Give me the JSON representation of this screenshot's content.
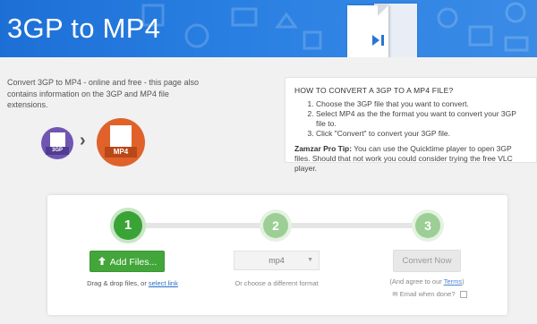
{
  "banner": {
    "title": "3GP to MP4",
    "pattern_icons": [
      "image-icon",
      "music-icon",
      "video-icon",
      "document-icon",
      "archive-icon"
    ],
    "colors": {
      "background": "#1d6fd6",
      "accent": "#ffffff"
    }
  },
  "intro": {
    "text": "Convert 3GP to MP4 - online and free - this page also contains information on the 3GP and MP4 file extensions."
  },
  "formats": {
    "from": {
      "label": "3GP",
      "color": "#6f56b2"
    },
    "to": {
      "label": "MP4",
      "color": "#e0622a"
    },
    "arrow": "›"
  },
  "howto": {
    "title": "HOW TO CONVERT A 3GP TO A MP4 FILE?",
    "steps": [
      "Choose the 3GP file that you want to convert.",
      "Select MP4 as the the format you want to convert your 3GP file to.",
      "Click \"Convert\" to convert your 3GP file."
    ],
    "tip_label": "Zamzar Pro Tip:",
    "tip_text": " You can use the Quicktime player to open 3GP files. Should that not work you could consider trying the free VLC player."
  },
  "converter": {
    "steps": [
      "1",
      "2",
      "3"
    ],
    "add_files_label": "Add Files...",
    "drag_text": "Drag & drop files, or ",
    "select_link": "select link",
    "format_value": "mp4",
    "format_hint": "Or choose a different format",
    "convert_label": "Convert Now",
    "agree_text": "(And agree to our ",
    "terms_link": "Terms",
    "agree_close": ")",
    "email_label": "Email when done?",
    "colors": {
      "step_active": "#3aa335",
      "step_inactive": "#9ccf95",
      "button": "#43a63a"
    }
  }
}
